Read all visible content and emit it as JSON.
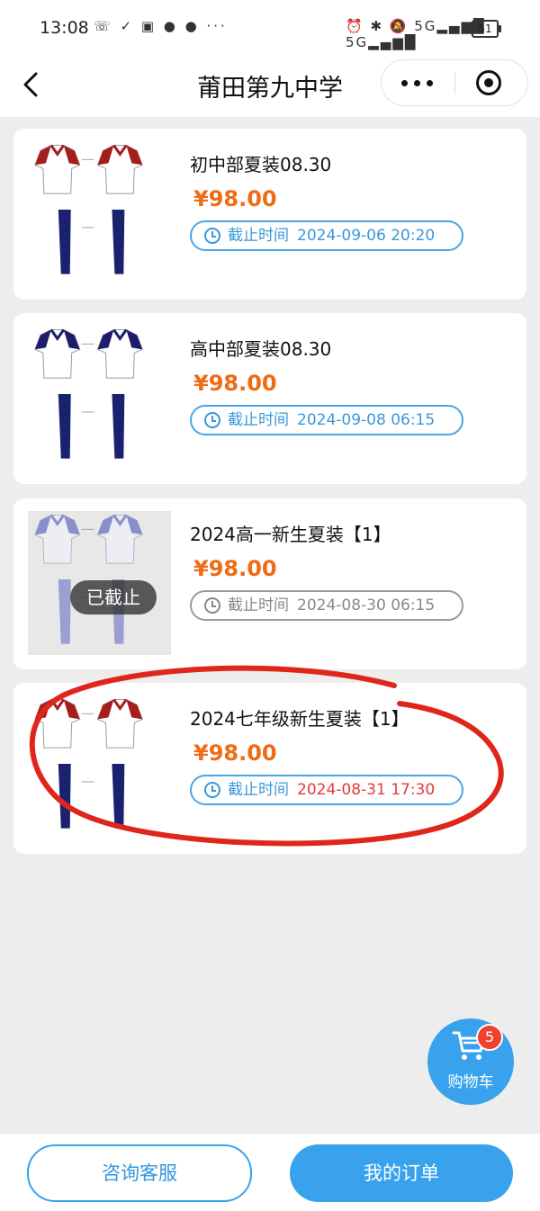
{
  "status_bar": {
    "time": "13:08",
    "left_icons": "☏ ✓ ▣ ● ● ···",
    "right_icons": "⏰ ✱ 🔕 5G▂▄▆█ 5G▂▄▆█",
    "battery": "51"
  },
  "nav": {
    "title": "莆田第九中学",
    "back_icon": "chevron-left-icon",
    "more_icon": "more-dots-icon",
    "close_icon": "mini-program-close-icon"
  },
  "products": [
    {
      "name": "初中部夏装08.30",
      "price": "¥98.00",
      "deadline_label": "截止时间",
      "deadline_value": "2024-09-06 20:20",
      "collar_color": "#a41e1e",
      "expired": false
    },
    {
      "name": "高中部夏装08.30",
      "price": "¥98.00",
      "deadline_label": "截止时间",
      "deadline_value": "2024-09-08 06:15",
      "collar_color": "#1b1f6b",
      "expired": false
    },
    {
      "name": "2024高一新生夏装【1】",
      "price": "¥98.00",
      "deadline_label": "截止时间",
      "deadline_value": "2024-08-30 06:15",
      "collar_color": "#8a8fc9",
      "expired": true,
      "expired_badge": "已截止"
    },
    {
      "name": "2024七年级新生夏装【1】",
      "price": "¥98.00",
      "deadline_label": "截止时间",
      "deadline_value": "2024-08-31 17:30",
      "collar_color": "#a41e1e",
      "expired": false,
      "deadline_highlight": true
    }
  ],
  "cart": {
    "label": "购物车",
    "badge_count": "5",
    "icon": "shopping-cart-icon"
  },
  "bottom": {
    "service_label": "咨询客服",
    "orders_label": "我的订单"
  },
  "colors": {
    "accent_blue": "#38a2ec",
    "price_orange": "#ef6c16",
    "highlight_red": "#e53935",
    "annotation_red": "#e0261c"
  }
}
